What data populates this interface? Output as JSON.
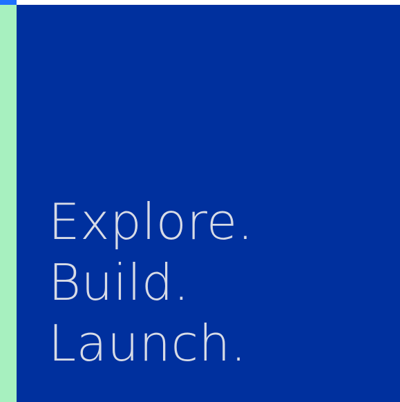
{
  "colors": {
    "corner_accent": "#1f70ff",
    "side_stripe": "#a7f0bf",
    "hero_background": "#00309e",
    "hero_text": "#d7dbe6"
  },
  "hero": {
    "lines": [
      "Explore.",
      "Build.",
      "Launch."
    ]
  }
}
